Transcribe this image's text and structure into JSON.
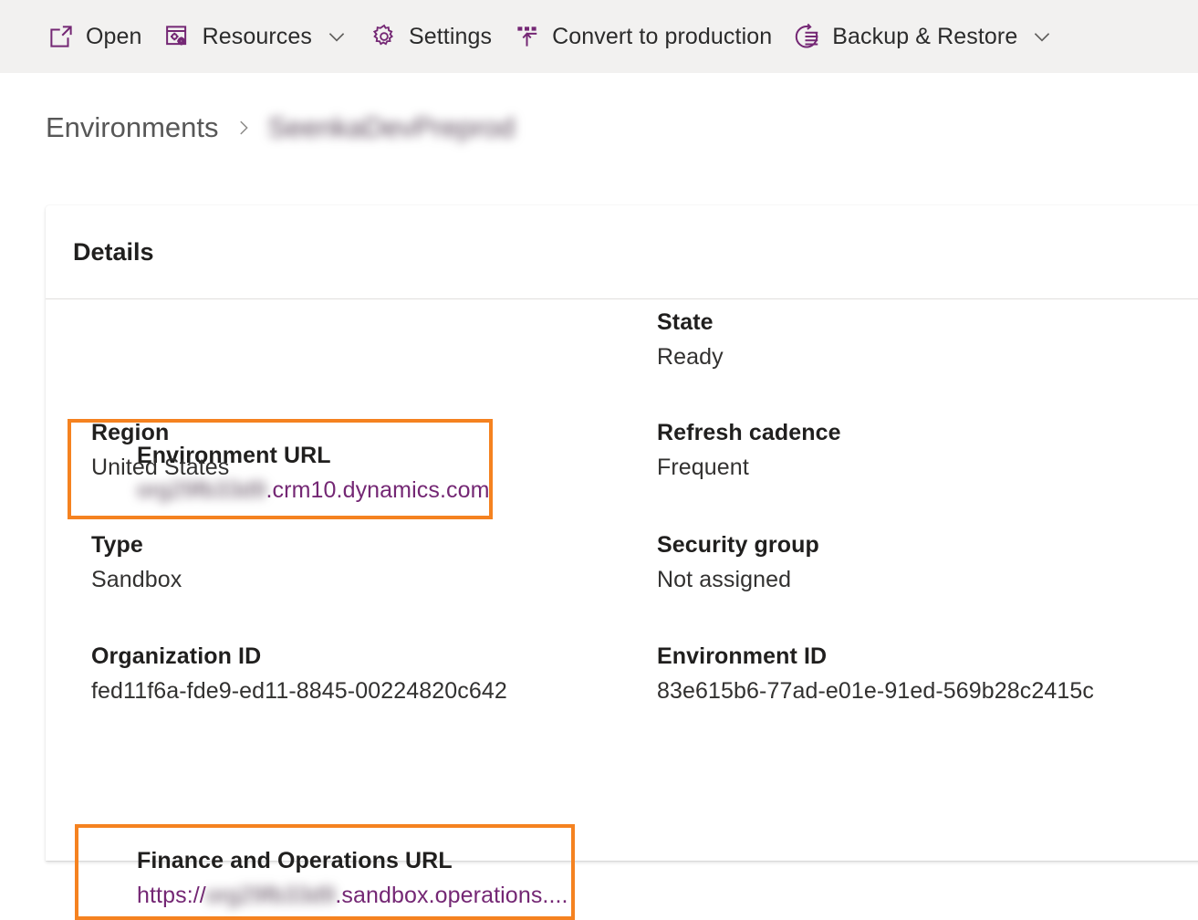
{
  "commandbar": {
    "items": [
      {
        "label": "Open",
        "icon": "open-in-new-window-icon",
        "has_chevron": false
      },
      {
        "label": "Resources",
        "icon": "resources-icon",
        "has_chevron": true
      },
      {
        "label": "Settings",
        "icon": "gear-icon",
        "has_chevron": false
      },
      {
        "label": "Convert to production",
        "icon": "convert-up-arrow-icon",
        "has_chevron": false
      },
      {
        "label": "Backup & Restore",
        "icon": "backup-restore-icon",
        "has_chevron": true
      }
    ]
  },
  "breadcrumb": {
    "root": "Environments",
    "separator": "chevron-right-icon",
    "current": "SeenkaDevPreprod"
  },
  "details": {
    "title": "Details",
    "left_column": [
      {
        "label": "Environment URL",
        "value_prefix": "org29fb33d9",
        "value_suffix": ".crm10.dynamics.com",
        "is_link": true,
        "highlighted": true
      },
      {
        "label": "Region",
        "value": "United States"
      },
      {
        "label": "Type",
        "value": "Sandbox"
      },
      {
        "label": "Organization ID",
        "value": "fed11f6a-fde9-ed11-8845-00224820c642"
      },
      {
        "label": "Finance and Operations URL",
        "value_prefix_plain": "https://",
        "value_prefix": "org29fb33d9",
        "value_suffix": ".sandbox.operations....",
        "is_link": true,
        "highlighted": true
      }
    ],
    "right_column": [
      {
        "label": "State",
        "value": "Ready"
      },
      {
        "label": "Refresh cadence",
        "value": "Frequent"
      },
      {
        "label": "Security group",
        "value": "Not assigned"
      },
      {
        "label": "Environment ID",
        "value": "83e615b6-77ad-e01e-91ed-569b28c2415c"
      }
    ]
  },
  "colors": {
    "brand_purple": "#742774",
    "link_purple": "#742774",
    "highlight_orange": "#f58220",
    "commandbar_bg": "#f2f1f0",
    "text_primary": "#201f1e"
  }
}
